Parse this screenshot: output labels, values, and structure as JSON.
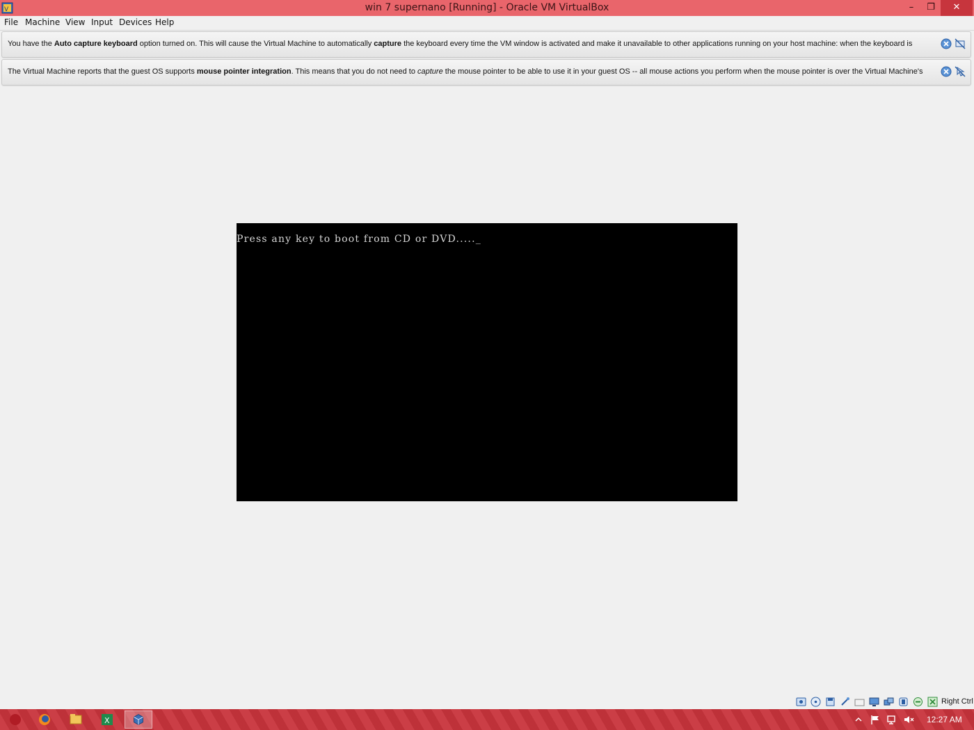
{
  "window": {
    "title": "win 7 supernano [Running] - Oracle VM VirtualBox",
    "app_icon": "virtualbox-icon",
    "minimize_glyph": "–",
    "maximize_glyph": "❐",
    "close_glyph": "✕"
  },
  "menu": {
    "items": [
      "File",
      "Machine",
      "View",
      "Input",
      "Devices",
      "Help"
    ]
  },
  "notifications": [
    {
      "text_parts": {
        "a": "You have the ",
        "b": "Auto capture keyboard",
        "c": " option turned on. This will cause the Virtual Machine to automatically ",
        "d": "capture",
        "e": " the keyboard every time the VM window is activated and make it unavailable to other applications running on your host machine: when the keyboard is"
      },
      "close_icon": "close-popup-icon",
      "dont_show_icon": "do-not-show-again-icon"
    },
    {
      "text_parts": {
        "a": "The Virtual Machine reports that the guest OS supports ",
        "b": "mouse pointer integration",
        "c": ". This means that you do not need to ",
        "d": "capture",
        "e": " the mouse pointer to be able to use it in your guest OS -- all mouse actions you perform when the mouse pointer is over the Virtual Machine's"
      },
      "close_icon": "close-popup-icon",
      "dont_show_icon": "do-not-show-again-icon"
    }
  ],
  "vm_screen": {
    "boot_text": "Press any key to boot from CD or DVD....._",
    "background": "#000000",
    "text_color": "#d8d8d8"
  },
  "statusbar": {
    "icons": [
      "hard-disk-icon",
      "optical-drive-icon",
      "floppy-icon",
      "usb-icon",
      "shared-folders-icon",
      "display-icon",
      "network-icon",
      "recording-icon",
      "cpu-icon",
      "mouse-integration-icon",
      "keyboard-capture-icon"
    ],
    "host_key": "Right Ctrl"
  },
  "taskbar": {
    "apps": [
      "start-icon",
      "firefox-icon",
      "file-explorer-icon",
      "excel-icon",
      "virtualbox-icon"
    ],
    "active_app": "virtualbox-icon",
    "tray_icons": [
      "show-hidden-icons-chevron",
      "action-center-flag-icon",
      "network-icon",
      "volume-muted-icon"
    ],
    "time": "12:27 AM",
    "color": "#c8343c"
  },
  "colors": {
    "titlebar": "#e9656b",
    "close_button": "#c7353d",
    "window_bg": "#f0f0f0"
  }
}
